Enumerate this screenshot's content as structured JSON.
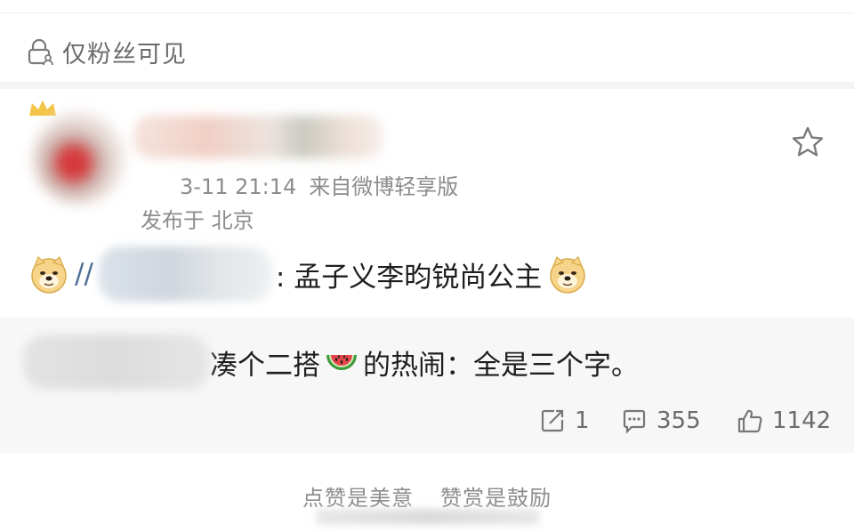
{
  "visibility": {
    "label": "仅粉丝可见"
  },
  "post": {
    "meta_time": "3-11 21:14",
    "meta_source": "来自微博轻享版",
    "location": "发布于 北京",
    "forward_prefix": "//",
    "text": ": 孟子义李昀锐尚公主"
  },
  "quote": {
    "text_before": "凑个二搭",
    "text_after": "的热闹：全是三个字。"
  },
  "stats": {
    "reposts": "1",
    "comments": "355",
    "likes": "1142"
  },
  "footer": {
    "left": "点赞是美意",
    "right": "赞赏是鼓励"
  },
  "icons": {
    "visibility": "lock-person-icon",
    "favorite": "star-icon",
    "emoji": "doge-emoji-icon",
    "watermelon": "watermelon-emoji-icon",
    "repost": "repost-icon",
    "comment": "comment-icon",
    "like": "thumbs-up-icon"
  }
}
